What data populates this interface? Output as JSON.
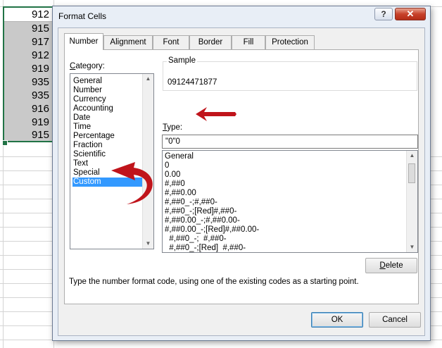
{
  "sheet": {
    "cells": [
      "912",
      "915",
      "917",
      "912",
      "919",
      "935",
      "935",
      "916",
      "919",
      "915"
    ]
  },
  "dialog": {
    "title": "Format Cells",
    "help_label": "?",
    "close_label": "✕",
    "tabs": [
      {
        "label": "Number",
        "active": true
      },
      {
        "label": "Alignment",
        "active": false
      },
      {
        "label": "Font",
        "active": false
      },
      {
        "label": "Border",
        "active": false
      },
      {
        "label": "Fill",
        "active": false
      },
      {
        "label": "Protection",
        "active": false
      }
    ],
    "category_label_underlined": "C",
    "category_label_rest": "ategory:",
    "categories": [
      "General",
      "Number",
      "Currency",
      "Accounting",
      "Date",
      "Time",
      "Percentage",
      "Fraction",
      "Scientific",
      "Text",
      "Special",
      "Custom"
    ],
    "selected_category": "Custom",
    "sample_label": "Sample",
    "sample_value": "09124471877",
    "type_label_underlined": "T",
    "type_label_rest": "ype:",
    "type_value": "\"0\"0",
    "formats": [
      "General",
      "0",
      "0.00",
      "#,##0",
      "#,##0.00",
      "#,##0_-;#,##0-",
      "#,##0_-;[Red]#,##0-",
      "#,##0.00_-;#,##0.00-",
      "#,##0.00_-;[Red]#,##0.00-",
      "  #,##0_-;  #,##0-",
      "  #,##0_-;[Red]  #,##0-"
    ],
    "delete_label_underlined": "D",
    "delete_label_rest": "elete",
    "hint": "Type the number format code, using one of the existing codes as a starting point.",
    "ok_label": "OK",
    "cancel_label": "Cancel"
  },
  "colors": {
    "selection_highlight": "#3399ff",
    "annotation_arrow": "#c0141b",
    "selection_border": "#217346"
  }
}
